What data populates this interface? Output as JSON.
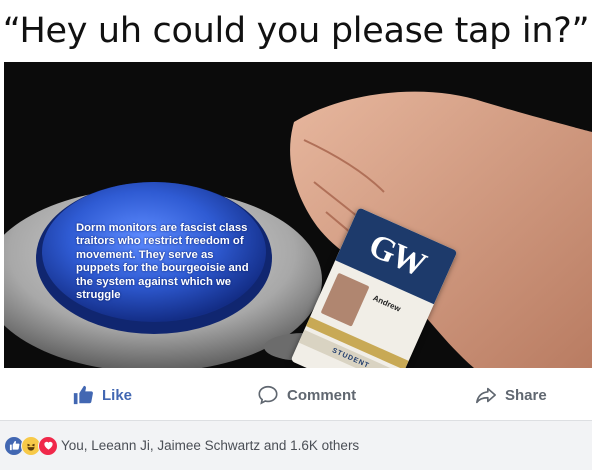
{
  "meme": {
    "caption": "“Hey uh could you please tap in?”",
    "button_text": "Dorm monitors are fascist class traitors who restrict freedom of movement. They serve as puppets for the bourgeoisie and the system against which we struggle",
    "id_card": {
      "logo": "GW",
      "name": "Andrew",
      "role": "STUDENT"
    }
  },
  "actions": {
    "like": {
      "label": "Like",
      "icon": "thumbs-up-icon",
      "color": "#4267b2"
    },
    "comment": {
      "label": "Comment",
      "icon": "comment-icon"
    },
    "share": {
      "label": "Share",
      "icon": "share-icon"
    }
  },
  "reactions": {
    "icons": [
      "like-reaction-icon",
      "haha-reaction-icon",
      "love-reaction-icon"
    ],
    "summary": "You, Leeann Ji, Jaimee Schwartz and 1.6K others"
  },
  "colors": {
    "like_blue": "#4267b2",
    "button_blue": "#2f5bd3",
    "love_red": "#f0284a",
    "haha_yellow": "#f7c948"
  }
}
